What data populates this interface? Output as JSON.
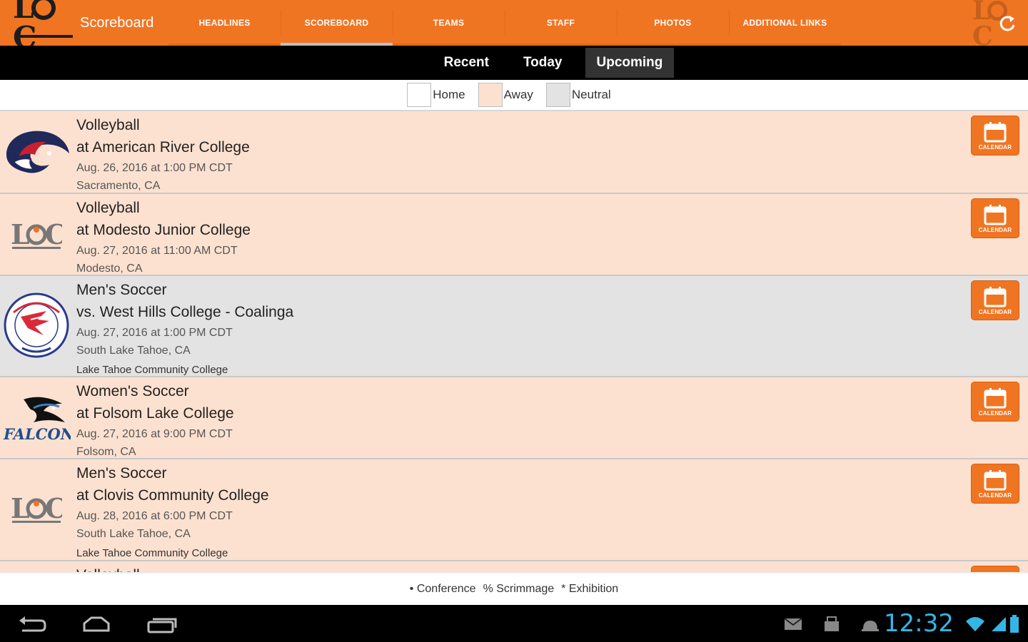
{
  "app": {
    "logo_text": "LTCC",
    "title": "Scoreboard"
  },
  "nav": {
    "tabs": [
      {
        "label": "HEADLINES",
        "active": false
      },
      {
        "label": "SCOREBOARD",
        "active": true
      },
      {
        "label": "TEAMS",
        "active": false
      },
      {
        "label": "STAFF",
        "active": false
      },
      {
        "label": "PHOTOS",
        "active": false
      },
      {
        "label": "ADDITIONAL LINKS",
        "active": false
      }
    ]
  },
  "subtabs": [
    {
      "label": "Recent",
      "active": false
    },
    {
      "label": "Today",
      "active": false
    },
    {
      "label": "Upcoming",
      "active": true
    }
  ],
  "legend": [
    {
      "label": "Home",
      "color": "#ffffff"
    },
    {
      "label": "Away",
      "color": "#fde1d0"
    },
    {
      "label": "Neutral",
      "color": "#e3e3e3"
    }
  ],
  "games": [
    {
      "sport": "Volleyball",
      "opponent": "at American River College",
      "datetime": "Aug. 26, 2016 at 1:00 PM CDT",
      "location": "Sacramento, CA",
      "host": "",
      "type": "away",
      "icon": "american-river-hawk-logo",
      "calendar_label": "CALENDAR"
    },
    {
      "sport": "Volleyball",
      "opponent": "at Modesto Junior College",
      "datetime": "Aug. 27, 2016 at 11:00 AM CDT",
      "location": "Modesto, CA",
      "host": "",
      "type": "away",
      "icon": "ltcc-logo",
      "calendar_label": "CALENDAR"
    },
    {
      "sport": "Men's Soccer",
      "opponent": "vs. West Hills College - Coalinga",
      "datetime": "Aug. 27, 2016 at 1:00 PM CDT",
      "location": "South Lake Tahoe, CA",
      "host": "Lake Tahoe Community College",
      "type": "neutral",
      "icon": "west-hills-falcon-logo",
      "calendar_label": "CALENDAR"
    },
    {
      "sport": "Women's Soccer",
      "opponent": "at Folsom Lake College",
      "datetime": "Aug. 27, 2016 at 9:00 PM CDT",
      "location": "Folsom, CA",
      "host": "",
      "type": "away",
      "icon": "folsom-falcons-logo",
      "calendar_label": "CALENDAR",
      "logo_text": "FALCONS"
    },
    {
      "sport": "Men's Soccer",
      "opponent": "at Clovis Community College",
      "datetime": "Aug. 28, 2016 at 6:00 PM CDT",
      "location": "South Lake Tahoe, CA",
      "host": "Lake Tahoe Community College",
      "type": "away",
      "icon": "ltcc-logo",
      "calendar_label": "CALENDAR"
    },
    {
      "sport": "Volleyball",
      "opponent": "",
      "datetime": "",
      "location": "",
      "host": "",
      "type": "away",
      "icon": "",
      "calendar_label": ""
    }
  ],
  "footer": {
    "conference": "• Conference",
    "scrimmage": "% Scrimmage",
    "exhibition": "* Exhibition"
  },
  "system": {
    "clock": "12:32"
  },
  "colors": {
    "accent": "#f07522",
    "away_bg": "#fde1d0",
    "neutral_bg": "#e3e3e3",
    "clock": "#35b5e5"
  }
}
